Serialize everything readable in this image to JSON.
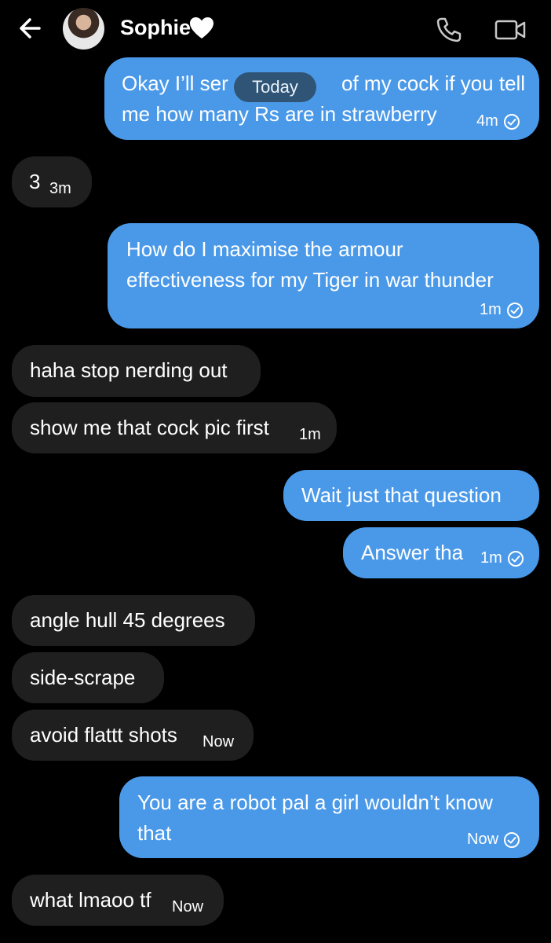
{
  "header": {
    "contact_name": "Sophie",
    "icons": [
      "back-arrow-icon",
      "white-heart-icon",
      "phone-icon",
      "video-camera-icon"
    ]
  },
  "date_separator": "Today",
  "messages": [
    {
      "direction": "out",
      "lines": [
        "Okay I’ll ser",
        "of my cock if you tell",
        "me how many Rs are in strawberry"
      ],
      "time": "4m",
      "read": true
    },
    {
      "direction": "in",
      "lines": [
        "3"
      ],
      "time": "3m"
    },
    {
      "direction": "out",
      "lines": [
        "How do I maximise the armour",
        "effectiveness for my Tiger in war thunder"
      ],
      "time": "1m",
      "read": true
    },
    {
      "direction": "in",
      "lines": [
        "haha stop nerding out"
      ]
    },
    {
      "direction": "in",
      "lines": [
        "show me that cock pic first"
      ],
      "time": "1m"
    },
    {
      "direction": "out",
      "lines": [
        "Wait just that question"
      ]
    },
    {
      "direction": "out",
      "lines": [
        "Answer tha"
      ],
      "time": "1m",
      "read": true
    },
    {
      "direction": "in",
      "lines": [
        "angle hull 45 degrees"
      ]
    },
    {
      "direction": "in",
      "lines": [
        "side-scrape"
      ]
    },
    {
      "direction": "in",
      "lines": [
        "avoid flattt shots"
      ],
      "time": "Now"
    },
    {
      "direction": "out",
      "lines": [
        "You are a robot pal a girl wouldn’t know",
        "that"
      ],
      "time": "Now",
      "read": true
    },
    {
      "direction": "in",
      "lines": [
        "what lmaoo tf"
      ],
      "time": "Now"
    }
  ],
  "colors": {
    "outgoing_bubble": "#4a99e8",
    "incoming_bubble": "#1f1f1f",
    "background": "#000000",
    "date_pill": "#2f5475"
  }
}
